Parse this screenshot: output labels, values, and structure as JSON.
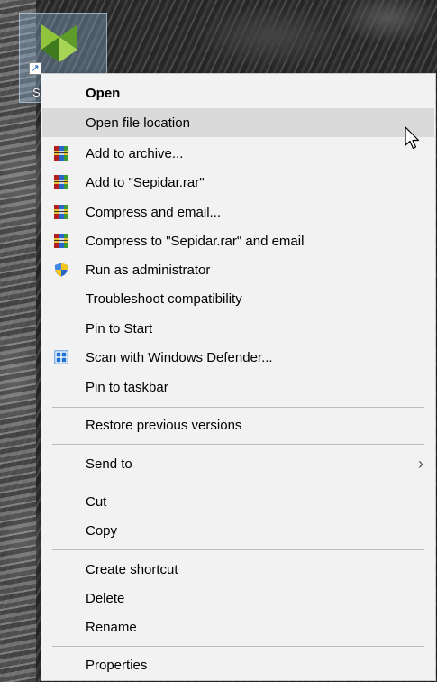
{
  "desktop": {
    "icon_label": "S",
    "icon_logo": "sepidar-logo-icon",
    "shortcut_glyph": "↗"
  },
  "menu": {
    "items": [
      {
        "label": "Open",
        "bold": true
      },
      {
        "label": "Open file location",
        "hover": true
      },
      {
        "label": "Add to archive...",
        "icon": "winrar-icon"
      },
      {
        "label": "Add to \"Sepidar.rar\"",
        "icon": "winrar-icon"
      },
      {
        "label": "Compress and email...",
        "icon": "winrar-icon"
      },
      {
        "label": "Compress to \"Sepidar.rar\" and email",
        "icon": "winrar-icon"
      },
      {
        "label": "Run as administrator",
        "icon": "uac-shield-icon"
      },
      {
        "label": "Troubleshoot compatibility"
      },
      {
        "label": "Pin to Start"
      },
      {
        "label": "Scan with Windows Defender...",
        "icon": "windows-defender-icon"
      },
      {
        "label": "Pin to taskbar"
      },
      {
        "label": "Restore previous versions"
      },
      {
        "label": "Send to",
        "submenu": true,
        "submenu_glyph": "›"
      },
      {
        "label": "Cut"
      },
      {
        "label": "Copy"
      },
      {
        "label": "Create shortcut"
      },
      {
        "label": "Delete"
      },
      {
        "label": "Rename"
      },
      {
        "label": "Properties"
      }
    ]
  },
  "colors": {
    "menu_background": "#f2f2f2",
    "hover_background": "#dadada",
    "selection_tint": "#96bee6"
  }
}
